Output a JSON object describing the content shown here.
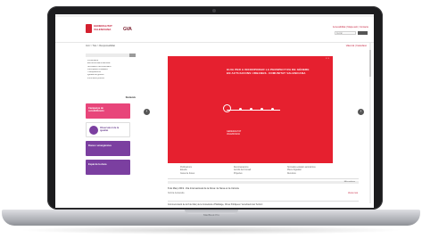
{
  "device": {
    "base_label": "MacBook Pro"
  },
  "site": {
    "logo_text": "GENERALITAT VALENCIANA",
    "logo2_text": "GVA",
    "top_links": "Accessibilitat | Mapa web | Contacte",
    "search_placeholder": "Cercar",
    "breadcrumb": "Inici  >  Tots  >  Responsabilitat",
    "lang": "Valencià | Castellano"
  },
  "sidebar": {
    "items": [
      "Presentació",
      "Estructura administrativa",
      "Normativa i documentació",
      "Participació ciutadana",
      "Transparència",
      "Igualtat de gènere",
      "Informació pública"
    ],
    "section_label": "Destacats",
    "banners": [
      "Campanya de sensibilització",
      "Observatori de la igualtat",
      "Dones i emergències",
      "Espai de la dona"
    ]
  },
  "hero": {
    "title": "GUIA PER A INCORPORAR LA PERSPECTIVA DE GÈNERE EN ACTUACIONS URBANES. COMUNITAT VALENCIANA",
    "small_text": "GENERALITAT VALENCIANA",
    "caption": "1 / 5",
    "prev_arrow": "‹",
    "next_arrow": "›"
  },
  "info": {
    "col1": [
      "Publicacions",
      "Estudis",
      "Guies de bones"
    ],
    "col2": [
      "Recomanacions",
      "Acords del Consell",
      "Projectes"
    ],
    "col3": [
      "Normativa estatal i autonòmica",
      "Plans d'igualtat",
      "Recursos"
    ]
  },
  "news": {
    "bar_label": "Més notícies",
    "title": "8 de Març 2019 - Dia Internacional de la Dona i la Nena en la Ciència",
    "subtitle": "Notícia destacada",
    "link": "Veure més",
    "item": "Commemoració de la 8 de Març de la Conselleria d'Habitatge, Obres Públiques i Vertebració del Territori"
  },
  "colors": {
    "accent": "#e6202f",
    "purple": "#7b3fa0",
    "pink": "#e8457a"
  },
  "icons": [
    "search-icon",
    "chevron-left-icon",
    "chevron-right-icon"
  ]
}
